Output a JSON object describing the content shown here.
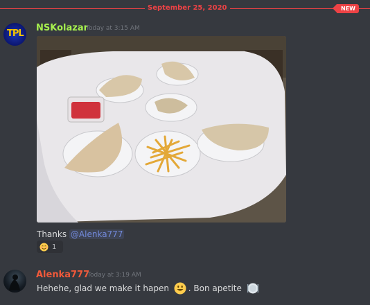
{
  "divider": {
    "date": "September 25, 2020",
    "new_badge": "NEW"
  },
  "messages": [
    {
      "username": "NSKolazar",
      "username_color": "#a6f04e",
      "timestamp": "Today at 3:15 AM",
      "avatar_text": "TPL",
      "text_prefix": "Thanks ",
      "mention": "@Alenka777",
      "reaction": {
        "emoji": "blush-emoji",
        "count": "1"
      }
    },
    {
      "username": "Alenka777",
      "username_color": "#f0593a",
      "timestamp": "Today at 3:19 AM",
      "text_part1": "Hehehe, glad we make it hapen ",
      "text_part2": ". Bon apetite "
    }
  ],
  "colors": {
    "background": "#36393f",
    "divider": "#ed4245",
    "mention": "#7289da"
  }
}
